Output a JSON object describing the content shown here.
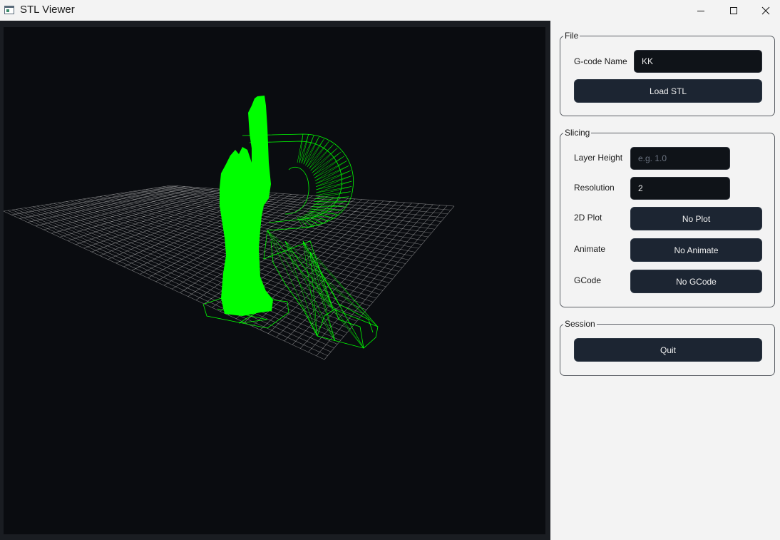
{
  "window": {
    "title": "STL Viewer",
    "icons": {
      "app": "stl-viewer-app-icon",
      "minimize": "minimize-icon",
      "maximize": "maximize-icon",
      "close": "close-icon"
    }
  },
  "viewport": {
    "background": "#0a0c10",
    "grid_color": "#cfcfcf",
    "model_color": "#00ff00",
    "grid_divisions": 40
  },
  "file_group": {
    "title": "File",
    "gcode_name_label": "G-code Name",
    "gcode_name_value": "KK",
    "load_button": "Load STL"
  },
  "slicing_group": {
    "title": "Slicing",
    "layer_height_label": "Layer Height",
    "layer_height_value": "",
    "layer_height_placeholder": "e.g. 1.0",
    "resolution_label": "Resolution",
    "resolution_value": "2",
    "plot_label": "2D Plot",
    "plot_button": "No Plot",
    "animate_label": "Animate",
    "animate_button": "No Animate",
    "gcode_label": "GCode",
    "gcode_button": "No GCode"
  },
  "session_group": {
    "title": "Session",
    "quit_button": "Quit"
  }
}
